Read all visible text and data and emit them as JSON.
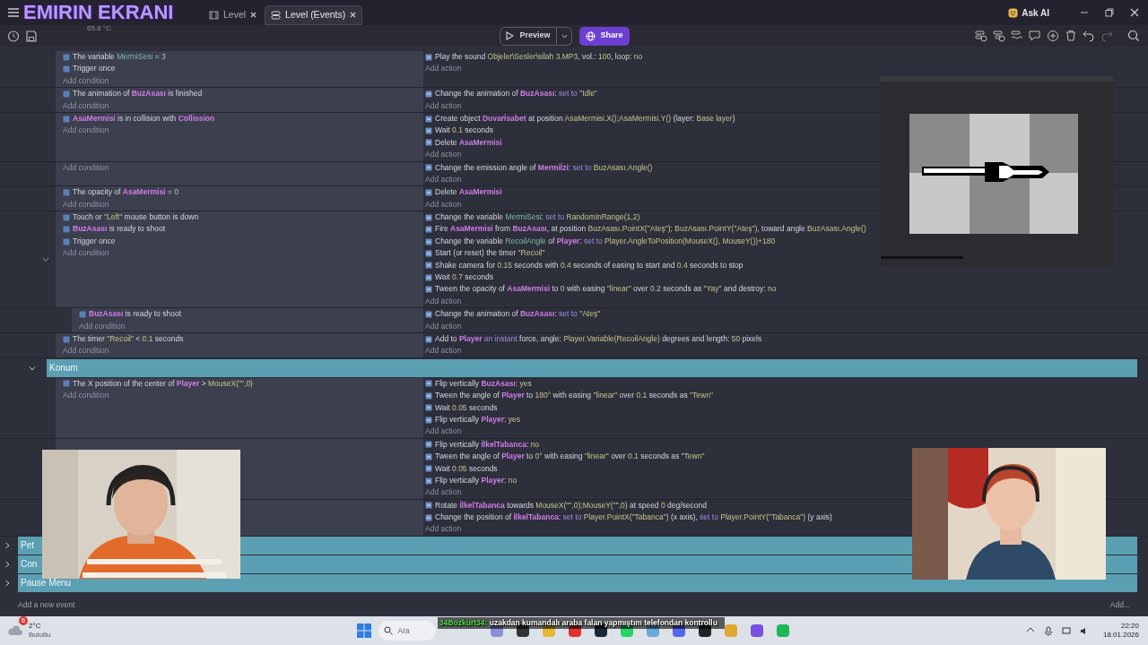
{
  "overlay": {
    "title": "EMIRIN EKRANI",
    "cpu_temp": "65.8 °C"
  },
  "tabs": [
    {
      "label": "Level",
      "selected": false
    },
    {
      "label": "Level (Events)",
      "selected": true
    }
  ],
  "ask_ai": "Ask AI",
  "toolbar": {
    "preview": "Preview",
    "share": "Share"
  },
  "events": [
    {
      "kind": "event",
      "conditions": [
        [
          {
            "text": "The variable "
          },
          {
            "text": "MermiSesi",
            "kind": "var"
          },
          {
            "text": " = "
          },
          {
            "text": "3",
            "kind": "val"
          }
        ],
        [
          {
            "text": "Trigger once"
          }
        ]
      ],
      "add_condition": "Add condition",
      "actions": [
        [
          {
            "text": "Play the sound "
          },
          {
            "text": "Objeler\\Sesler\\silah 3.MP3",
            "kind": "val"
          },
          {
            "text": ", vol.: "
          },
          {
            "text": "100",
            "kind": "val"
          },
          {
            "text": ", loop: "
          },
          {
            "text": "no",
            "kind": "val"
          }
        ]
      ],
      "add_action": "Add action"
    },
    {
      "kind": "event",
      "conditions": [
        [
          {
            "text": "The animation of "
          },
          {
            "text": "BuzAsası",
            "kind": "obj"
          },
          {
            "text": " is finished"
          }
        ]
      ],
      "add_condition": "Add condition",
      "actions": [
        [
          {
            "text": "Change the animation of "
          },
          {
            "text": "BuzAsası",
            "kind": "obj"
          },
          {
            "text": ": "
          },
          {
            "text": "set to ",
            "kind": "op"
          },
          {
            "text": "\"Idle\"",
            "kind": "val"
          }
        ]
      ],
      "add_action": "Add action"
    },
    {
      "kind": "event",
      "conditions": [
        [
          {
            "text": "AsaMermisi",
            "kind": "obj"
          },
          {
            "text": " is in collision with "
          },
          {
            "text": "Collission",
            "kind": "obj"
          }
        ]
      ],
      "add_condition": "Add condition",
      "actions": [
        [
          {
            "text": "Create object "
          },
          {
            "text": "Duvarİsabet",
            "kind": "obj"
          },
          {
            "text": " at position "
          },
          {
            "text": "AsaMermisi.X();AsaMermisi.Y()",
            "kind": "val"
          },
          {
            "text": " (layer: "
          },
          {
            "text": "Base layer",
            "kind": "val"
          },
          {
            "text": ")"
          }
        ],
        [
          {
            "text": "Wait "
          },
          {
            "text": "0.1",
            "kind": "val"
          },
          {
            "text": " seconds"
          }
        ],
        [
          {
            "text": "Delete "
          },
          {
            "text": "AsaMermisi",
            "kind": "obj"
          }
        ]
      ],
      "add_action": "Add action"
    },
    {
      "kind": "event",
      "add_condition": "Add condition",
      "actions": [
        [
          {
            "text": "Change the emission angle of "
          },
          {
            "text": "Mermiİzi",
            "kind": "obj"
          },
          {
            "text": ": "
          },
          {
            "text": "set to ",
            "kind": "op"
          },
          {
            "text": "BuzAsası.Angle()",
            "kind": "val"
          }
        ]
      ],
      "add_action": "Add action"
    },
    {
      "kind": "event",
      "conditions": [
        [
          {
            "text": "The opacity of "
          },
          {
            "text": "AsaMermisi",
            "kind": "obj"
          },
          {
            "text": " = "
          },
          {
            "text": "0",
            "kind": "val"
          }
        ]
      ],
      "add_condition": "Add condition",
      "actions": [
        [
          {
            "text": "Delete "
          },
          {
            "text": "AsaMermisi",
            "kind": "obj"
          }
        ]
      ],
      "add_action": "Add action"
    },
    {
      "kind": "event",
      "expanded": true,
      "conditions": [
        [
          {
            "text": "Touch or "
          },
          {
            "text": "\"Left\"",
            "kind": "val"
          },
          {
            "text": " mouse button is down"
          }
        ],
        [
          {
            "text": "BuzAsası",
            "kind": "obj"
          },
          {
            "text": " is ready to shoot"
          }
        ],
        [
          {
            "text": "Trigger once"
          }
        ]
      ],
      "add_condition": "Add condition",
      "actions": [
        [
          {
            "text": "Change the variable "
          },
          {
            "text": "MermiSesi",
            "kind": "var"
          },
          {
            "text": ": "
          },
          {
            "text": "set to ",
            "kind": "op"
          },
          {
            "text": "RandomInRange(1,2)",
            "kind": "val"
          }
        ],
        [
          {
            "text": "Fire "
          },
          {
            "text": "AsaMermisi",
            "kind": "obj"
          },
          {
            "text": " from "
          },
          {
            "text": "BuzAsası",
            "kind": "obj"
          },
          {
            "text": ", at position "
          },
          {
            "text": "BuzAsası.PointX(\"Ateş\"); BuzAsası.PointY(\"Ateş\")",
            "kind": "val"
          },
          {
            "text": ", toward angle "
          },
          {
            "text": "BuzAsası.Angle()",
            "kind": "val"
          }
        ],
        [
          {
            "text": "Change the variable "
          },
          {
            "text": "RecoilAngle",
            "kind": "var"
          },
          {
            "text": " of "
          },
          {
            "text": "Player",
            "kind": "obj"
          },
          {
            "text": ": "
          },
          {
            "text": "set to ",
            "kind": "op"
          },
          {
            "text": "Player.AngleToPosition(MouseX(), MouseY())+180",
            "kind": "val"
          }
        ],
        [
          {
            "text": "Start (or reset) the timer "
          },
          {
            "text": "\"Recoil\"",
            "kind": "val"
          }
        ],
        [
          {
            "text": "Shake camera for "
          },
          {
            "text": "0.15",
            "kind": "val"
          },
          {
            "text": " seconds with "
          },
          {
            "text": "0.4",
            "kind": "val"
          },
          {
            "text": " seconds of easing to start and "
          },
          {
            "text": "0.4",
            "kind": "val"
          },
          {
            "text": " seconds to stop"
          }
        ],
        [
          {
            "text": "Wait "
          },
          {
            "text": "0.7",
            "kind": "val"
          },
          {
            "text": " seconds"
          }
        ],
        [
          {
            "text": "Tween the opacity of "
          },
          {
            "text": "AsaMermisi",
            "kind": "obj"
          },
          {
            "text": " to "
          },
          {
            "text": "0",
            "kind": "val"
          },
          {
            "text": " with easing "
          },
          {
            "text": "\"linear\"",
            "kind": "val"
          },
          {
            "text": " over "
          },
          {
            "text": "0.2",
            "kind": "val"
          },
          {
            "text": " seconds as "
          },
          {
            "text": "\"Yay\"",
            "kind": "val"
          },
          {
            "text": " and destroy: "
          },
          {
            "text": "no",
            "kind": "val"
          }
        ]
      ],
      "add_action": "Add action",
      "children": [
        {
          "kind": "event",
          "conditions": [
            [
              {
                "text": "BuzAsası",
                "kind": "obj"
              },
              {
                "text": " is ready to shoot"
              }
            ]
          ],
          "add_condition": "Add condition",
          "actions": [
            [
              {
                "text": "Change the animation of "
              },
              {
                "text": "BuzAsası",
                "kind": "obj"
              },
              {
                "text": ": "
              },
              {
                "text": "set to ",
                "kind": "op"
              },
              {
                "text": "\"Ateş\"",
                "kind": "val"
              }
            ]
          ],
          "add_action": "Add action"
        }
      ]
    },
    {
      "kind": "event",
      "conditions": [
        [
          {
            "text": "The timer "
          },
          {
            "text": "\"Recoil\"",
            "kind": "val"
          },
          {
            "text": " < "
          },
          {
            "text": "0.1",
            "kind": "val"
          },
          {
            "text": " seconds"
          }
        ]
      ],
      "add_condition": "Add condition",
      "actions": [
        [
          {
            "text": "Add to "
          },
          {
            "text": "Player",
            "kind": "obj"
          },
          {
            "text": " an instant",
            "kind": "op"
          },
          {
            "text": " force, angle: "
          },
          {
            "text": "Player.Variable(RecoilAngle)",
            "kind": "val"
          },
          {
            "text": " degrees and length: "
          },
          {
            "text": "50",
            "kind": "val"
          },
          {
            "text": " pixels"
          }
        ]
      ],
      "add_action": "Add action"
    },
    {
      "kind": "group",
      "title": "Konum",
      "expanded": true,
      "children": [
        {
          "kind": "event",
          "conditions": [
            [
              {
                "text": "The X position of the center of "
              },
              {
                "text": "Player",
                "kind": "obj"
              },
              {
                "text": " > "
              },
              {
                "text": "MouseX(\"\",0)",
                "kind": "val"
              }
            ]
          ],
          "add_condition": "Add condition",
          "actions": [
            [
              {
                "text": "Flip vertically "
              },
              {
                "text": "BuzAsası",
                "kind": "obj"
              },
              {
                "text": ": "
              },
              {
                "text": "yes",
                "kind": "val"
              }
            ],
            [
              {
                "text": "Tween the angle of "
              },
              {
                "text": "Player",
                "kind": "obj"
              },
              {
                "text": " to "
              },
              {
                "text": "180°",
                "kind": "val"
              },
              {
                "text": " with easing "
              },
              {
                "text": "\"linear\"",
                "kind": "val"
              },
              {
                "text": " over "
              },
              {
                "text": "0.1",
                "kind": "val"
              },
              {
                "text": " seconds as "
              },
              {
                "text": "\"Tewn\"",
                "kind": "val"
              }
            ],
            [
              {
                "text": "Wait "
              },
              {
                "text": "0.05",
                "kind": "val"
              },
              {
                "text": " seconds"
              }
            ],
            [
              {
                "text": "Flip vertically "
              },
              {
                "text": "Player",
                "kind": "obj"
              },
              {
                "text": ": "
              },
              {
                "text": "yes",
                "kind": "val"
              }
            ]
          ],
          "add_action": "Add action"
        },
        {
          "kind": "event",
          "actions": [
            [
              {
                "text": "Flip vertically "
              },
              {
                "text": "İlkelTabanca",
                "kind": "obj"
              },
              {
                "text": ": "
              },
              {
                "text": "no",
                "kind": "val"
              }
            ],
            [
              {
                "text": "Tween the angle of "
              },
              {
                "text": "Player",
                "kind": "obj"
              },
              {
                "text": " to "
              },
              {
                "text": "0°",
                "kind": "val"
              },
              {
                "text": " with easing "
              },
              {
                "text": "\"linear\"",
                "kind": "val"
              },
              {
                "text": " over "
              },
              {
                "text": "0.1",
                "kind": "val"
              },
              {
                "text": " seconds as "
              },
              {
                "text": "\"Tewn\"",
                "kind": "val"
              }
            ],
            [
              {
                "text": "Wait "
              },
              {
                "text": "0.05",
                "kind": "val"
              },
              {
                "text": " seconds"
              }
            ],
            [
              {
                "text": "Flip vertically "
              },
              {
                "text": "Player",
                "kind": "obj"
              },
              {
                "text": ": "
              },
              {
                "text": "no",
                "kind": "val"
              }
            ]
          ],
          "add_action": "Add action"
        },
        {
          "kind": "event",
          "actions": [
            [
              {
                "text": "Rotate "
              },
              {
                "text": "İlkelTabanca",
                "kind": "obj"
              },
              {
                "text": " towards "
              },
              {
                "text": "MouseX(\"\",0);MouseY(\"\",0)",
                "kind": "val"
              },
              {
                "text": " at speed "
              },
              {
                "text": "0",
                "kind": "val"
              },
              {
                "text": " deg/second"
              }
            ],
            [
              {
                "text": "Change the position of "
              },
              {
                "text": "İlkelTabanca",
                "kind": "obj"
              },
              {
                "text": ": "
              },
              {
                "text": "set to ",
                "kind": "op"
              },
              {
                "text": "Player.PointX(\"Tabanca\")",
                "kind": "val"
              },
              {
                "text": " (x axis), "
              },
              {
                "text": "set to ",
                "kind": "op"
              },
              {
                "text": "Player.PointY(\"Tabanca\")",
                "kind": "val"
              },
              {
                "text": " (y axis)"
              }
            ]
          ],
          "add_action": "Add action"
        }
      ]
    },
    {
      "kind": "group",
      "title": "Pet",
      "expanded": false
    },
    {
      "kind": "group",
      "title": "Con",
      "expanded": false
    },
    {
      "kind": "group",
      "title": "Pause Menu",
      "expanded": false
    }
  ],
  "add_event": "Add a new event",
  "add_more": "Add...",
  "taskbar": {
    "notifications": "6",
    "temperature": "2°C",
    "weather": "Bulutlu",
    "search_placeholder": "Ara",
    "time": "22:20",
    "date": "18.01.2026"
  },
  "chat": {
    "user": "34Bozkurt34:",
    "message": "uzakdan kumandalı araba falan yapmıştım telefondan kontrollu"
  }
}
